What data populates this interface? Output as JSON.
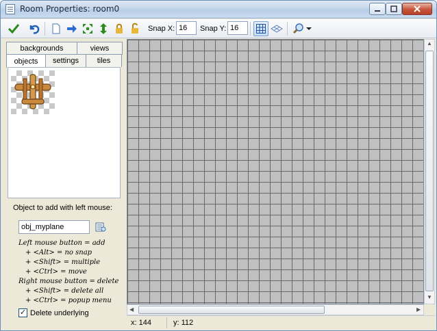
{
  "window": {
    "title": "Room Properties: room0"
  },
  "toolbar": {
    "snap_x_label": "Snap X:",
    "snap_x_value": "16",
    "snap_y_label": "Snap Y:",
    "snap_y_value": "16",
    "icons": [
      "check-icon",
      "undo-icon",
      "document-icon",
      "arrow-right-icon",
      "shift-expand-icon",
      "shift-vertical-icon",
      "lock-icon",
      "unlock-icon",
      "grid-icon",
      "isometric-grid-icon",
      "zoom-icon",
      "dropdown-arrow-icon"
    ]
  },
  "tabs": {
    "row1": [
      "backgrounds",
      "views"
    ],
    "row2": [
      "objects",
      "settings",
      "tiles"
    ],
    "active": "objects"
  },
  "panel": {
    "add_label": "Object to add with left mouse:",
    "object_value": "obj_myplane",
    "help": [
      "Left mouse button = add",
      "+ <Alt> = no snap",
      "+ <Shift> = multiple",
      "+ <Ctrl> = move",
      "Right mouse button = delete",
      "+ <Shift> = delete all",
      "+ <Ctrl> = popup menu"
    ],
    "delete_underlying_label": "Delete underlying",
    "delete_underlying_checked": true
  },
  "status": {
    "x": "x: 144",
    "y": "y: 112"
  },
  "colors": {
    "grid_fill": "#c0c0c0",
    "grid_line": "#6a6a6a",
    "accent": "#1c5180"
  }
}
